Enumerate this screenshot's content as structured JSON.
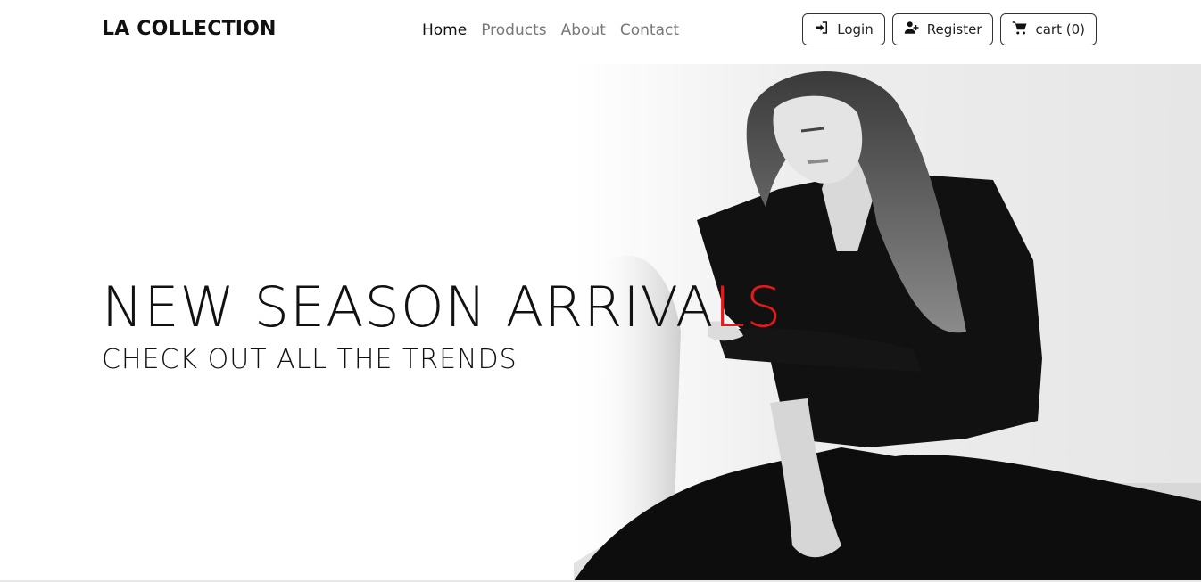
{
  "navbar": {
    "brand": "LA COLLECTION",
    "links": [
      "Home",
      "Products",
      "About",
      "Contact"
    ],
    "active": "Home",
    "login_label": "Login",
    "register_label": "Register",
    "cart_label": "cart (0)"
  },
  "hero": {
    "headline_main": "NEW SEASON ARRIVA",
    "headline_accent": "LS",
    "subheadline": "CHECK OUT ALL THE TRENDS",
    "accent_color": "#e31b1b"
  },
  "icons": {
    "login": "sign-in-icon",
    "register": "user-plus-icon",
    "cart": "cart-icon"
  }
}
